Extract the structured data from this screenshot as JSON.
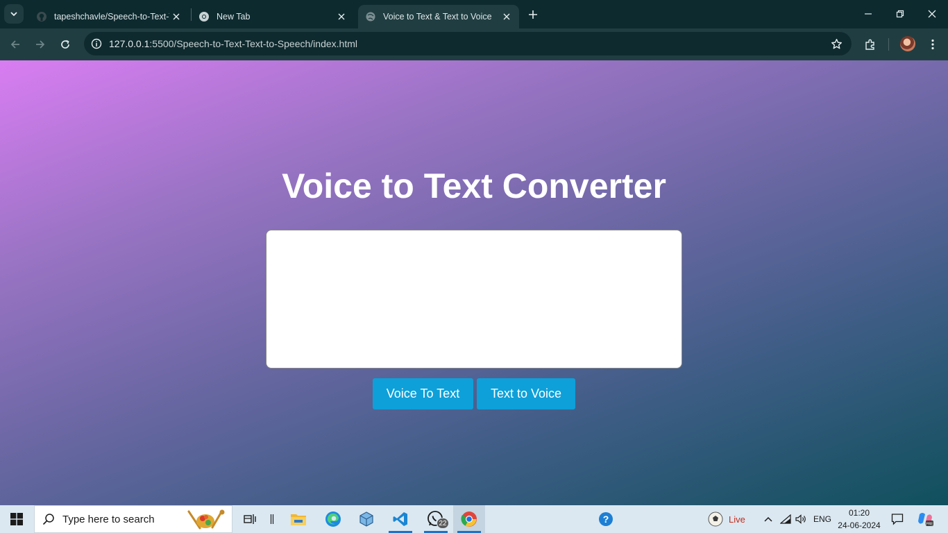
{
  "browser": {
    "tabs": [
      {
        "title": "tapeshchavle/Speech-to-Text-Te",
        "favicon": "github-icon",
        "active": false
      },
      {
        "title": "New Tab",
        "favicon": "chrome-icon",
        "active": false
      },
      {
        "title": "Voice to Text & Text to Voice",
        "favicon": "globe-icon",
        "active": true
      }
    ],
    "url_host": "127.0.0.1",
    "url_path": ":5500/Speech-to-Text-Text-to-Speech/index.html"
  },
  "page": {
    "heading": "Voice to Text Converter",
    "textarea_value": "",
    "buttons": {
      "voice_to_text": "Voice To Text",
      "text_to_voice": "Text to Voice"
    },
    "colors": {
      "button_bg": "#0ea0d9",
      "gradient_start": "#d97df2",
      "gradient_end": "#10505d"
    }
  },
  "taskbar": {
    "search_placeholder": "Type here to search",
    "whatsapp_badge": "22",
    "weather_label": "Live",
    "language": "ENG",
    "time": "01:20",
    "date": "24-06-2024"
  }
}
